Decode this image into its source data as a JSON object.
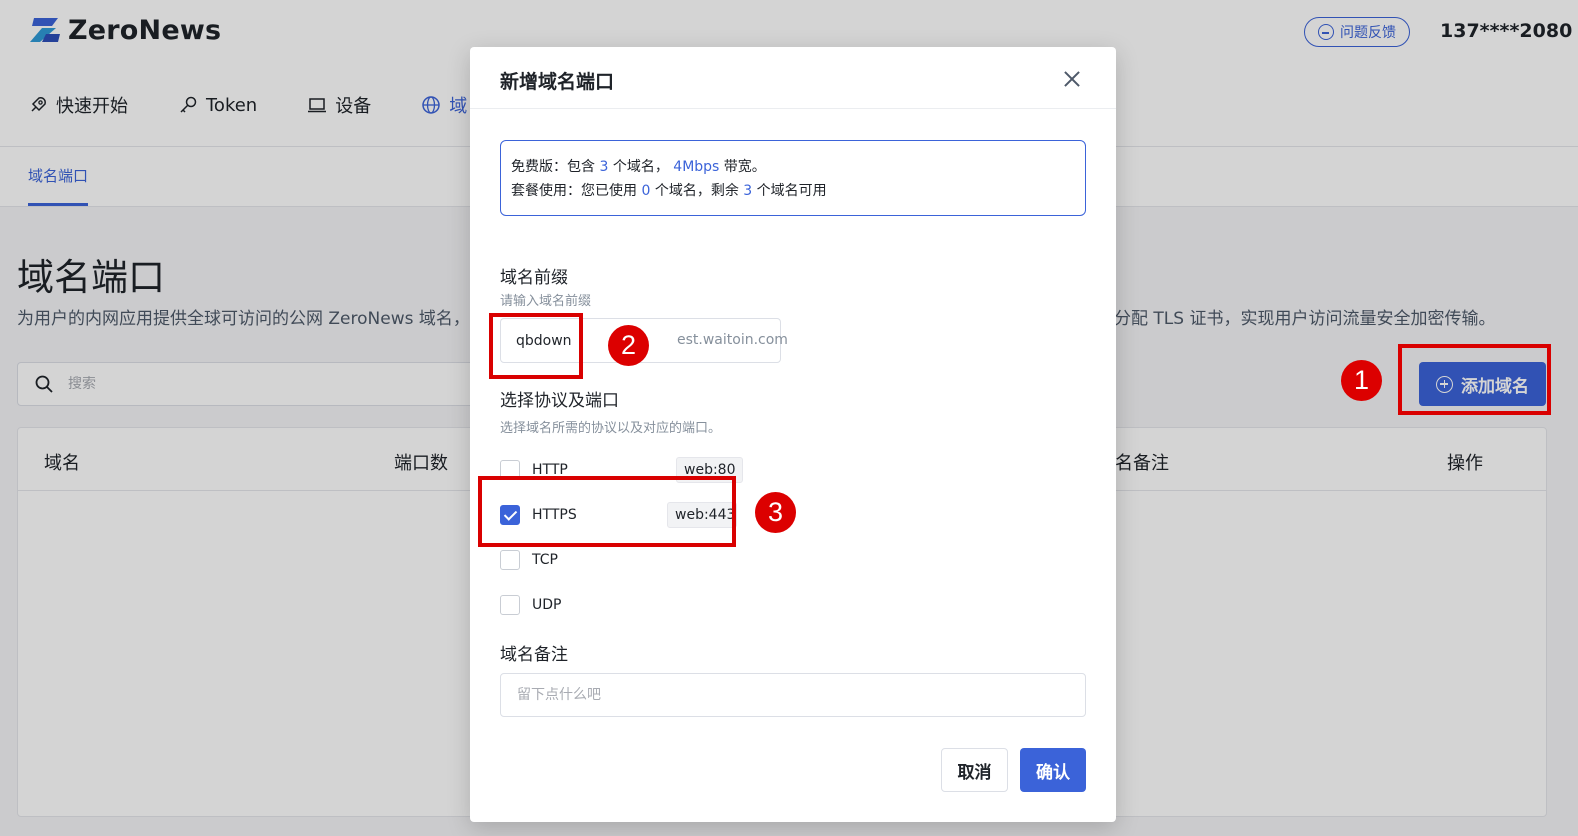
{
  "app": {
    "name": "ZeroNews",
    "feedback_label": "问题反馈",
    "user_phone": "137****2080"
  },
  "nav": {
    "items": [
      {
        "label": "快速开始",
        "icon": "rocket-icon"
      },
      {
        "label": "Token",
        "icon": "key-icon"
      },
      {
        "label": "设备",
        "icon": "laptop-icon"
      },
      {
        "label": "域",
        "icon": "globe-icon"
      }
    ]
  },
  "subtab": {
    "label": "域名端口"
  },
  "page": {
    "title": "域名端口",
    "description_left": "为用户的内网应用提供全球可访问的公网 ZeroNews 域名，",
    "description_right": "分配 TLS 证书，实现用户访问流量安全加密传输。",
    "search_placeholder": "搜索",
    "add_domain_label": "添加域名"
  },
  "table": {
    "columns": [
      "域名",
      "端口数",
      "名备注",
      "操作"
    ]
  },
  "modal": {
    "title": "新增域名端口",
    "plan": {
      "line1_prefix": "免费版：包含",
      "domain_quota": "3",
      "line1_mid": "个域名，",
      "bandwidth": "4Mbps",
      "line1_suffix": "带宽。",
      "line2_prefix": "套餐使用：您已使用",
      "used": "0",
      "line2_mid": "个域名，剩余",
      "remaining": "3",
      "line2_suffix": "个域名可用"
    },
    "prefix_label": "域名前缀",
    "prefix_hint": "请输入域名前缀",
    "prefix_value": "qbdown",
    "prefix_suffix": "est.waitoin.com",
    "protocol_label": "选择协议及端口",
    "protocol_hint": "选择域名所需的协议以及对应的端口。",
    "protocols": [
      {
        "name": "HTTP",
        "checked": false,
        "port": "web:80"
      },
      {
        "name": "HTTPS",
        "checked": true,
        "port": "web:443"
      },
      {
        "name": "TCP",
        "checked": false,
        "port": ""
      },
      {
        "name": "UDP",
        "checked": false,
        "port": ""
      }
    ],
    "remark_label": "域名备注",
    "remark_placeholder": "留下点什么吧",
    "cancel_label": "取消",
    "confirm_label": "确认"
  },
  "annotations": {
    "badge1": "1",
    "badge2": "2",
    "badge3": "3"
  },
  "colors": {
    "accent": "#3b63d9",
    "annotation_red": "#d90000"
  }
}
